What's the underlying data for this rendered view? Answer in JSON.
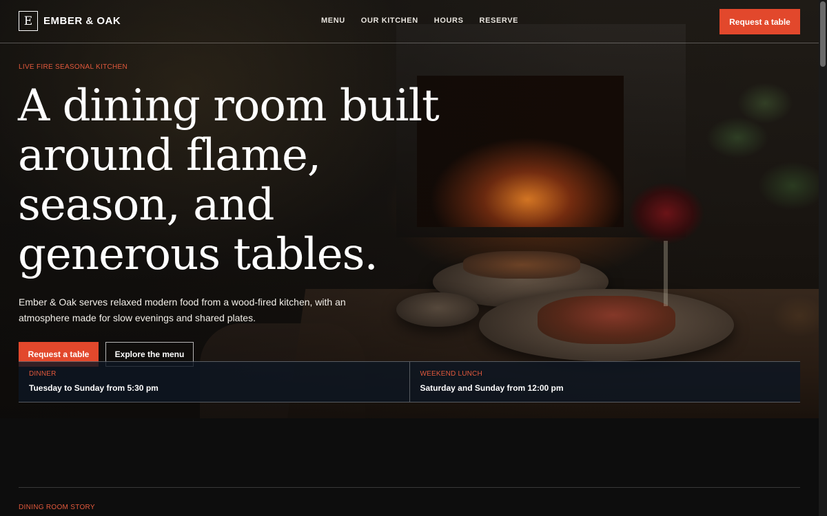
{
  "brand": {
    "logo_letter": "E",
    "name": "EMBER & OAK"
  },
  "nav": {
    "items": [
      "MENU",
      "OUR KITCHEN",
      "HOURS",
      "RESERVE"
    ],
    "cta_label": "Request a table"
  },
  "hero": {
    "eyebrow": "LIVE FIRE SEASONAL KITCHEN",
    "headline": "A dining room built around flame, season, and generous tables.",
    "intro": "Ember & Oak serves relaxed modern food from a wood-fired kitchen, with an atmosphere made for slow evenings and shared plates.",
    "primary_cta": "Request a table",
    "secondary_cta": "Explore the menu"
  },
  "hours": [
    {
      "label": "DINNER",
      "value": "Tuesday to Sunday from 5:30 pm"
    },
    {
      "label": "WEEKEND LUNCH",
      "value": "Saturday and Sunday from 12:00 pm"
    }
  ],
  "story": {
    "eyebrow": "DINING ROOM STORY"
  },
  "colors": {
    "accent": "#e2482c",
    "background": "#0d0d0d",
    "hours_strip": "#0e1622"
  }
}
